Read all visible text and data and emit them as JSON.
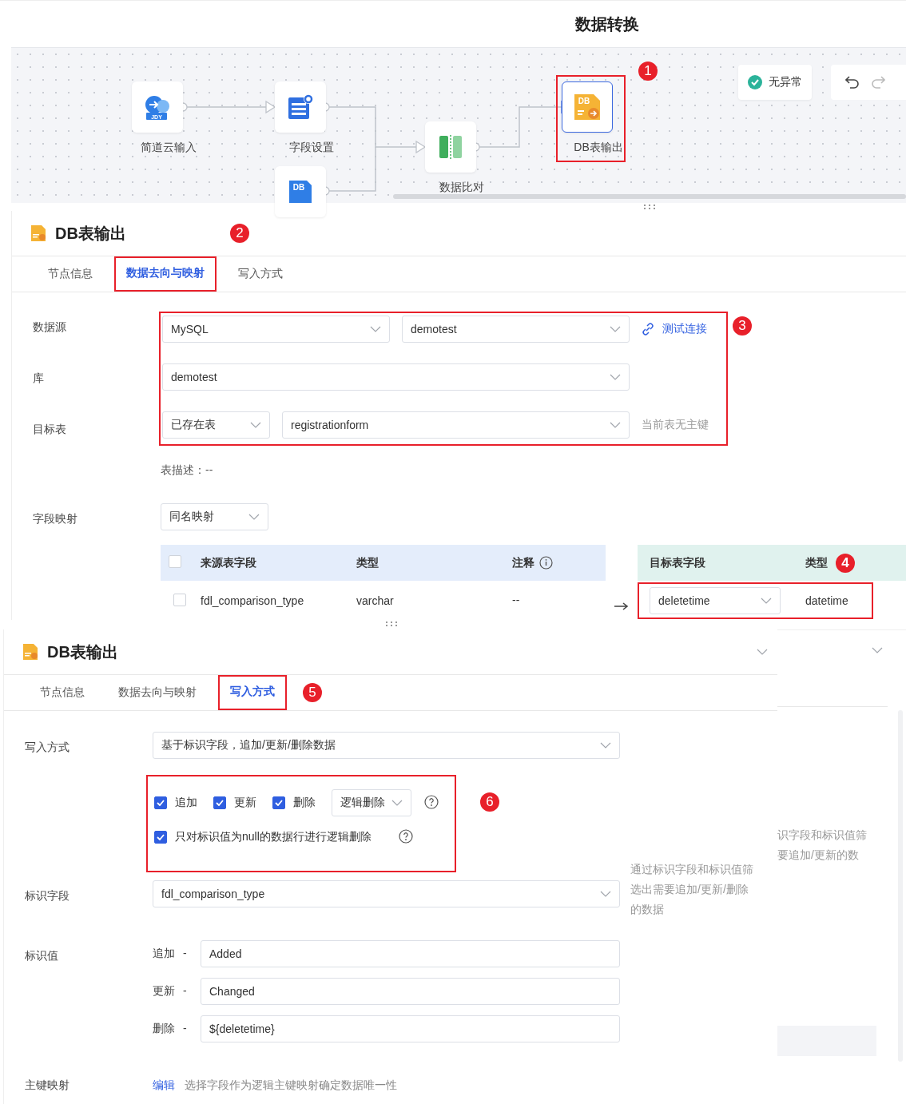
{
  "canvas": {
    "title": "数据转换",
    "status": "无异常",
    "annotation": "1",
    "nodes": [
      {
        "kind": "jdy",
        "label": "简道云输入",
        "icon_text": "JDY",
        "selected": false
      },
      {
        "kind": "fields",
        "label": "字段设置",
        "selected": false
      },
      {
        "kind": "db",
        "icon_text": "DB",
        "selected": false
      },
      {
        "kind": "compare",
        "label": "数据比对",
        "selected": false
      },
      {
        "kind": "dbout",
        "label": "DB表输出",
        "icon_text": "DB",
        "selected": true
      }
    ]
  },
  "panel1": {
    "title": "DB表输出",
    "annotation": "2",
    "tabs": [
      {
        "label": "节点信息",
        "selected": false
      },
      {
        "label": "数据去向与映射",
        "selected": true,
        "highlighted": true
      },
      {
        "label": "写入方式",
        "selected": false
      }
    ],
    "annotation_rows": "3",
    "datasource": {
      "label": "数据源",
      "type_value": "MySQL",
      "conn_value": "demotest",
      "test_link": "测试连接"
    },
    "library": {
      "label": "库",
      "value": "demotest"
    },
    "target": {
      "label": "目标表",
      "mode": "已存在表",
      "table": "registrationform",
      "hint": "当前表无主键"
    },
    "desc": "表描述：--",
    "mapping": {
      "label": "字段映射",
      "mode": "同名映射",
      "header_checked": false,
      "annotation": "4",
      "source_columns": [
        "来源表字段",
        "类型",
        "注释"
      ],
      "target_columns": [
        "目标表字段",
        "类型"
      ],
      "rows": [
        {
          "checked": false,
          "source": "fdl_comparison_type",
          "type": "varchar",
          "comment": "--",
          "target": "deletetime",
          "target_type": "datetime"
        }
      ]
    }
  },
  "panel2": {
    "title": "DB表输出",
    "annotation": "5",
    "tabs": [
      {
        "label": "节点信息",
        "selected": false
      },
      {
        "label": "数据去向与映射",
        "selected": false
      },
      {
        "label": "写入方式",
        "selected": true,
        "highlighted": true
      }
    ],
    "write_mode": {
      "label": "写入方式",
      "value": "基于标识字段，追加/更新/删除数据"
    },
    "annotation_options": "6",
    "options": [
      {
        "label": "追加",
        "checked": true
      },
      {
        "label": "更新",
        "checked": true
      },
      {
        "label": "删除",
        "checked": true
      }
    ],
    "delete_mode": "逻辑删除",
    "null_only": {
      "label": "只对标识值为null的数据行进行逻辑删除",
      "checked": true
    },
    "id_field": {
      "label": "标识字段",
      "value": "fdl_comparison_type",
      "hint": "通过标识字段和标识值筛选出需要追加/更新/删除的数据"
    },
    "id_values": {
      "label": "标识值",
      "items": [
        {
          "label": "追加",
          "separator": "-",
          "value": "Added"
        },
        {
          "label": "更新",
          "separator": "-",
          "value": "Changed"
        },
        {
          "label": "删除",
          "separator": "-",
          "value": "${deletetime}"
        }
      ]
    },
    "pk": {
      "label": "主键映射",
      "link": "编辑",
      "text": "选择字段作为逻辑主键映射确定数据唯一性"
    }
  },
  "background_fragment": {
    "lines": [
      "识字段和标识值筛",
      "要追加/更新的数"
    ]
  }
}
